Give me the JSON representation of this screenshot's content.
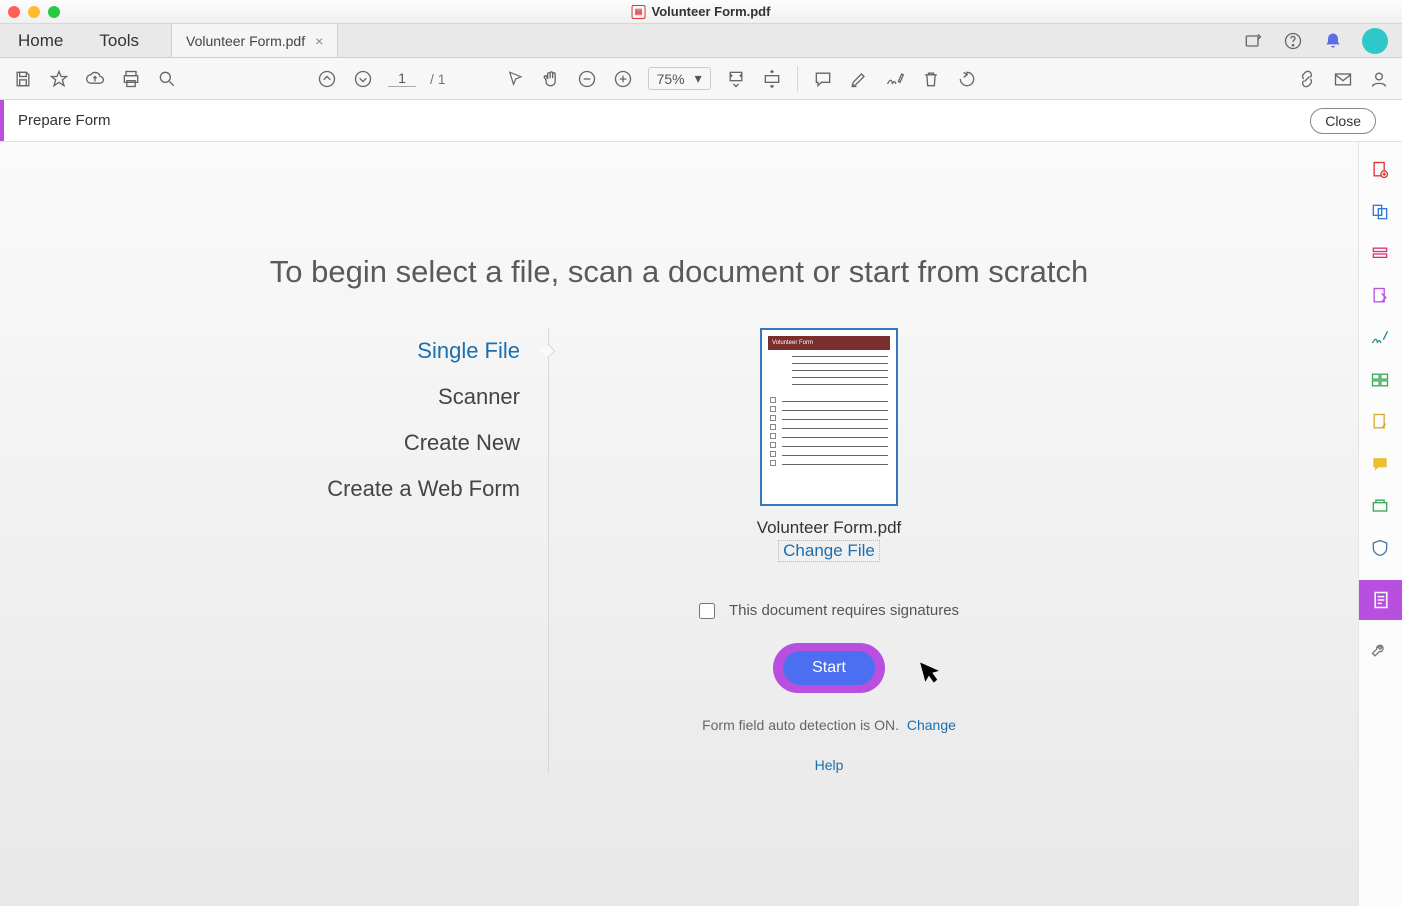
{
  "window": {
    "title": "Volunteer Form.pdf"
  },
  "tabs": {
    "home": "Home",
    "tools": "Tools",
    "file": "Volunteer Form.pdf"
  },
  "toolbar": {
    "page_current": "1",
    "page_total": "/ 1",
    "zoom": "75%"
  },
  "prepbar": {
    "label": "Prepare Form",
    "close": "Close"
  },
  "main": {
    "headline": "To begin select a file, scan a document or start from scratch",
    "options": {
      "single_file": "Single File",
      "scanner": "Scanner",
      "create_new": "Create New",
      "create_web_form": "Create a Web Form"
    },
    "thumbnail_title": "Volunteer Form",
    "filename": "Volunteer Form.pdf",
    "change_file": "Change File",
    "signatures_label": "This document requires signatures",
    "start": "Start",
    "auto_detect_text": "Form field auto detection is ON.",
    "auto_detect_change": "Change",
    "help": "Help"
  }
}
